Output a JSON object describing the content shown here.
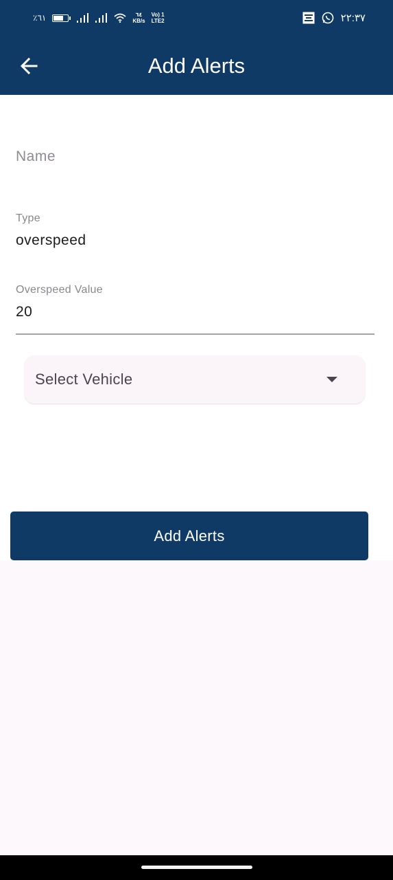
{
  "status_bar": {
    "battery_text": "٪٦١",
    "net_speed_value": "٦٤",
    "net_speed_unit": "KB/s",
    "volte_top": "Vo) 1",
    "volte_bottom": "LTE2",
    "time": "٢٢:٣٧"
  },
  "app_bar": {
    "title": "Add Alerts",
    "back_icon": "arrow-left-icon"
  },
  "form": {
    "name_placeholder": "Name",
    "type_label": "Type",
    "type_value": "overspeed",
    "overspeed_label": "Overspeed Value",
    "overspeed_value": "20",
    "vehicle_placeholder": "Select Vehicle"
  },
  "actions": {
    "submit_label": "Add Alerts"
  },
  "colors": {
    "primary": "#0f3a66",
    "background": "#fcf8fc"
  }
}
